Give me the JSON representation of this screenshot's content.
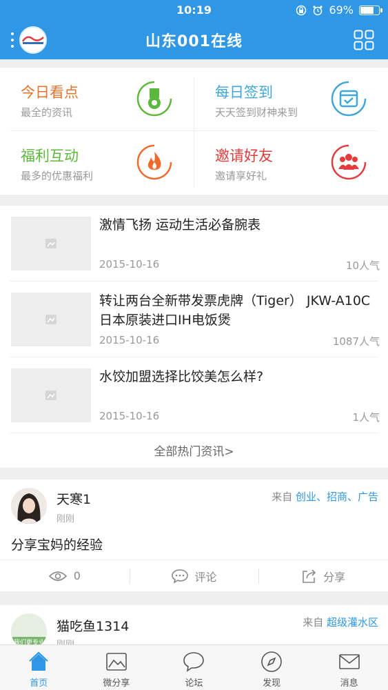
{
  "status_bar": {
    "time": "10:19",
    "battery": "69%",
    "battery_level": 0.69
  },
  "nav": {
    "title": "山东001在线"
  },
  "quick_links": [
    {
      "title": "今日看点",
      "subtitle": "最全的资讯",
      "color": "#e8732c",
      "icon": "medal-icon",
      "icon_color": "#5cb83a"
    },
    {
      "title": "每日签到",
      "subtitle": "天天签到财神来到",
      "color": "#3fa6dc",
      "icon": "calendar-check-icon",
      "icon_color": "#3fa6dc"
    },
    {
      "title": "福利互动",
      "subtitle": "最多的优惠福利",
      "color": "#5cb83a",
      "icon": "flame-icon",
      "icon_color": "#ef6a2b"
    },
    {
      "title": "邀请好友",
      "subtitle": "邀请享好礼",
      "color": "#e23c3c",
      "icon": "group-icon",
      "icon_color": "#e23c3c"
    }
  ],
  "news": {
    "items": [
      {
        "title": "激情飞扬 运动生活必备腕表",
        "date": "2015-10-16",
        "popularity": "10人气"
      },
      {
        "title": "转让两台全新带发票虎牌（Tiger） JKW-A10C 日本原装进口IH电饭煲",
        "date": "2015-10-16",
        "popularity": "1087人气"
      },
      {
        "title": "水饺加盟选择比饺美怎么样?",
        "date": "2015-10-16",
        "popularity": "1人气"
      }
    ],
    "more_label": "全部热门资讯>"
  },
  "posts": [
    {
      "user": "天寒1",
      "time": "刚刚",
      "from_prefix": "来自",
      "from_tag": "创业、招商、广告",
      "content": "分享宝妈的经验",
      "views": "0",
      "comment_label": "评论",
      "share_label": "分享"
    },
    {
      "user": "猫吃鱼1314",
      "time": "刚刚",
      "from_prefix": "来自",
      "from_tag": "超级灌水区",
      "avatar_text": "我们更专业"
    }
  ],
  "tabs": [
    {
      "label": "首页",
      "icon": "home-icon",
      "active": true
    },
    {
      "label": "微分享",
      "icon": "picture-icon",
      "active": false
    },
    {
      "label": "论坛",
      "icon": "chat-icon",
      "active": false
    },
    {
      "label": "发现",
      "icon": "compass-icon",
      "active": false
    },
    {
      "label": "消息",
      "icon": "mail-icon",
      "active": false
    }
  ],
  "colors": {
    "brand": "#2f97e6",
    "background": "#efefef"
  }
}
